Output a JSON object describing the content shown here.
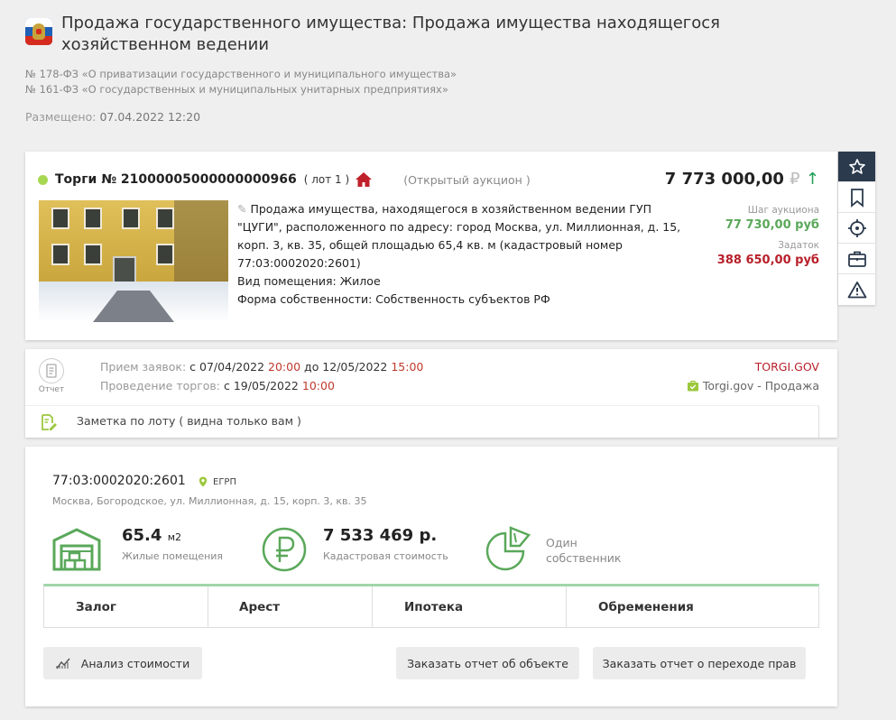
{
  "header": {
    "title": "Продажа государственного имущества: Продажа имущества находящегося хозяйственном ведении",
    "laws": [
      "№ 178-ФЗ «О приватизации государственного и муниципального имущества»",
      "№ 161-ФЗ «О государственных и муниципальных унитарных предприятиях»"
    ],
    "posted_label": "Размещено:",
    "posted_value": "07.04.2022 12:20"
  },
  "lot": {
    "title": "Торги № 21000005000000000966",
    "lot_label": "( лот 1 )",
    "auction_type": "(Открытый аукцион )",
    "price": "7 773 000,00",
    "currency": "₽",
    "trend": "↑",
    "description": "Продажа имущества, находящегося в хозяйственном ведении ГУП \"ЦУГИ\", расположенного по адресу: город Москва, ул. Миллионная, д. 15, корп. 3, кв. 35, общей площадью 65,4 кв. м (кадастровый номер 77:03:0002020:2601)",
    "premise_type": "Вид помещения: Жилое",
    "ownership": "Форма собственности: Собственность субъектов РФ",
    "step_label": "Шаг аукциона",
    "step_value": "77 730,00 руб",
    "deposit_label": "Задаток",
    "deposit_value": "388 650,00 руб",
    "status_color": "#a8d852"
  },
  "toolbar": {
    "icons": [
      "star-icon",
      "bookmark-icon",
      "target-icon",
      "briefcase-icon",
      "warning-icon"
    ]
  },
  "schedule": {
    "report_label": "Отчет",
    "apps_label": "Прием заявок:",
    "apps_from": "с 07/04/2022",
    "apps_from_time": "20:00",
    "apps_to": "до 12/05/2022",
    "apps_to_time": "15:00",
    "trade_label": "Проведение торгов:",
    "trade_date": "с 19/05/2022",
    "trade_time": "10:00",
    "source": "TORGI.GOV",
    "source_sub": "Torgi.gov - Продажа",
    "note": "Заметка по лоту ( видна только вам )"
  },
  "object": {
    "cad_number": "77:03:0002020:2601",
    "egrp": "ЕГРП",
    "address": "Москва, Богородское, ул. Миллионная, д. 15, корп. 3, кв. 35",
    "area_value": "65.4",
    "area_unit": "м2",
    "area_label": "Жилые помещения",
    "cost_value": "7 533 469 р.",
    "cost_label": "Кадастровая стоимость",
    "owner_line1": "Один",
    "owner_line2": "собственник",
    "tabs": [
      "Залог",
      "Арест",
      "Ипотека",
      "Обременения"
    ],
    "btn_analysis": "Анализ стоимости",
    "btn_report_object": "Заказать отчет об объекте",
    "btn_report_rights": "Заказать отчет о переходе прав"
  }
}
